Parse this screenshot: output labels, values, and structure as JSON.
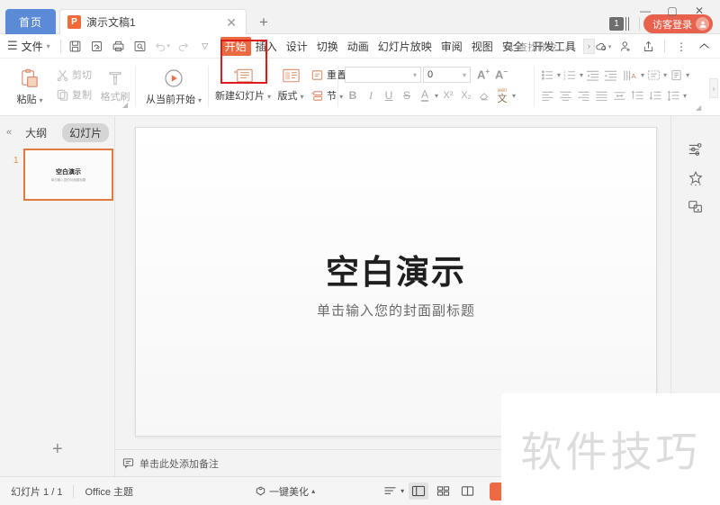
{
  "titlebar": {
    "home_tab": "首页",
    "doc_tab": {
      "label": "演示文稿1",
      "icon_letter": "P",
      "close": "✕"
    },
    "new_tab": "+",
    "notify_count": "1",
    "guest_login": "访客登录",
    "window_controls": {
      "minimize": "—",
      "maximize": "▢",
      "close": "✕"
    }
  },
  "menubar": {
    "file_label": "文件",
    "quick_access": [
      "save-icon",
      "save-as-cloud-icon",
      "print-icon",
      "print-preview-icon",
      "undo-icon",
      "redo-icon",
      "customize-qat-icon"
    ],
    "tabs": [
      {
        "label": "开始",
        "active": true
      },
      {
        "label": "插入",
        "active": false
      },
      {
        "label": "设计",
        "active": false
      },
      {
        "label": "切换",
        "active": false
      },
      {
        "label": "动画",
        "active": false
      },
      {
        "label": "幻灯片放映",
        "active": false
      },
      {
        "label": "审阅",
        "active": false
      },
      {
        "label": "视图",
        "active": false
      },
      {
        "label": "安全",
        "active": false
      },
      {
        "label": "开发工具",
        "active": false
      }
    ],
    "tab_overflow": "›",
    "search_placeholder": "查找命令...",
    "right_icons": [
      "cloud-sync-icon",
      "share-user-icon",
      "share-export-icon",
      "more-options-icon",
      "collapse-ribbon-icon"
    ]
  },
  "ribbon": {
    "clipboard": {
      "paste": "粘贴",
      "cut": "剪切",
      "copy": "复制",
      "format_painter": "格式刷"
    },
    "start_show": "从当前开始",
    "slides": {
      "new_slide": "新建幻灯片",
      "layout": "版式",
      "reset": "重置",
      "section": "节"
    },
    "font": {
      "name_value": "",
      "size_value": "0",
      "grow": "A",
      "shrink": "A",
      "bold": "B",
      "italic": "I",
      "underline": "U",
      "strikethrough": "S",
      "font_color": "A",
      "superscript": "X²",
      "subscript": "X₂",
      "clear_format": "clear-format-icon",
      "pinyin": "文"
    },
    "paragraph_icons": [
      "bullet-list-icon",
      "numbered-list-icon",
      "decrease-indent-icon",
      "increase-indent-icon",
      "text-direction-icon",
      "align-text-icon",
      "columns-icon",
      "align-left-icon",
      "align-center-icon",
      "align-right-icon",
      "justify-icon",
      "distribute-icon",
      "line-spacing-increase-icon",
      "line-spacing-decrease-icon",
      "line-spacing-icon"
    ],
    "overflow": "›"
  },
  "annotation": {
    "color": "#e01b1b",
    "target": "开始/插入 标签"
  },
  "left_panel": {
    "collapse": "«",
    "tabs": [
      {
        "label": "大纲",
        "active": false
      },
      {
        "label": "幻灯片",
        "active": true
      }
    ],
    "slides": [
      {
        "number": "1",
        "title": "空白演示",
        "subtitle": "单击输入您的封面副标题"
      }
    ],
    "add_slide": "+"
  },
  "slide": {
    "title": "空白演示",
    "subtitle": "单击输入您的封面副标题"
  },
  "notes": {
    "placeholder": "单击此处添加备注"
  },
  "right_sidebar": {
    "icons": [
      "properties-panel-icon",
      "design-ideas-icon",
      "selection-pane-icon"
    ]
  },
  "statusbar": {
    "slide_counter": "幻灯片 1 / 1",
    "theme": "Office 主题",
    "beautify": "一键美化",
    "beautify_arrow": "▴",
    "view_buttons": [
      "outline-view-icon",
      "normal-view-icon",
      "slide-sorter-icon",
      "reading-view-icon"
    ],
    "play": "play-icon",
    "play_dropdown": "▾"
  },
  "watermark": {
    "text": "软件技巧"
  },
  "colors": {
    "accent_orange": "#ea6a42",
    "tab_blue": "#5b8ad6",
    "login_red": "#e8614d",
    "annotation_red": "#e01b1b",
    "thumb_border": "#e2793d"
  }
}
